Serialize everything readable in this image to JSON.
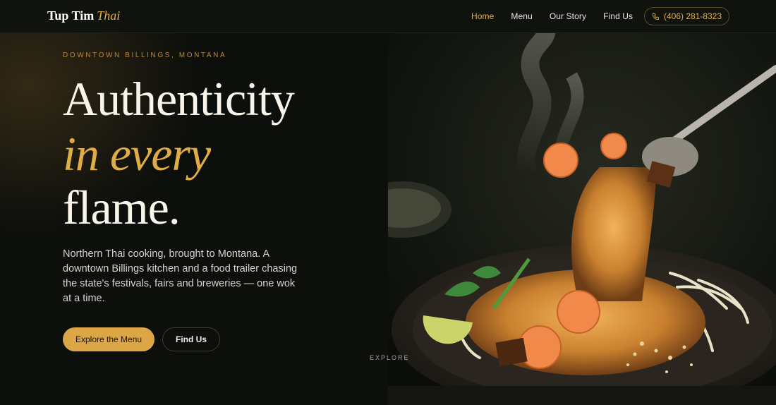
{
  "brand": {
    "name": "Tup Tim",
    "accent": "Thai"
  },
  "nav": {
    "items": [
      {
        "label": "Home",
        "active": true
      },
      {
        "label": "Menu",
        "active": false
      },
      {
        "label": "Our Story",
        "active": false
      },
      {
        "label": "Find Us",
        "active": false
      }
    ],
    "phone": "(406) 281-8323",
    "phone_icon": "phone-icon"
  },
  "hero": {
    "eyebrow": "DOWNTOWN BILLINGS, MONTANA",
    "headline_line1": "Authenticity",
    "headline_line2": "in every",
    "headline_line3": "flame.",
    "lede": "Northern Thai cooking, brought to Montana. A downtown Billings kitchen and a food trailer chasing the state's festivals, fairs and breweries — one wok at a time.",
    "primary_cta": "Explore the Menu",
    "secondary_cta": "Find Us",
    "scroll_label": "EXPLORE"
  },
  "colors": {
    "accent": "#e0ac45",
    "background": "#0d0f0c",
    "button_primary": "#dca646"
  }
}
